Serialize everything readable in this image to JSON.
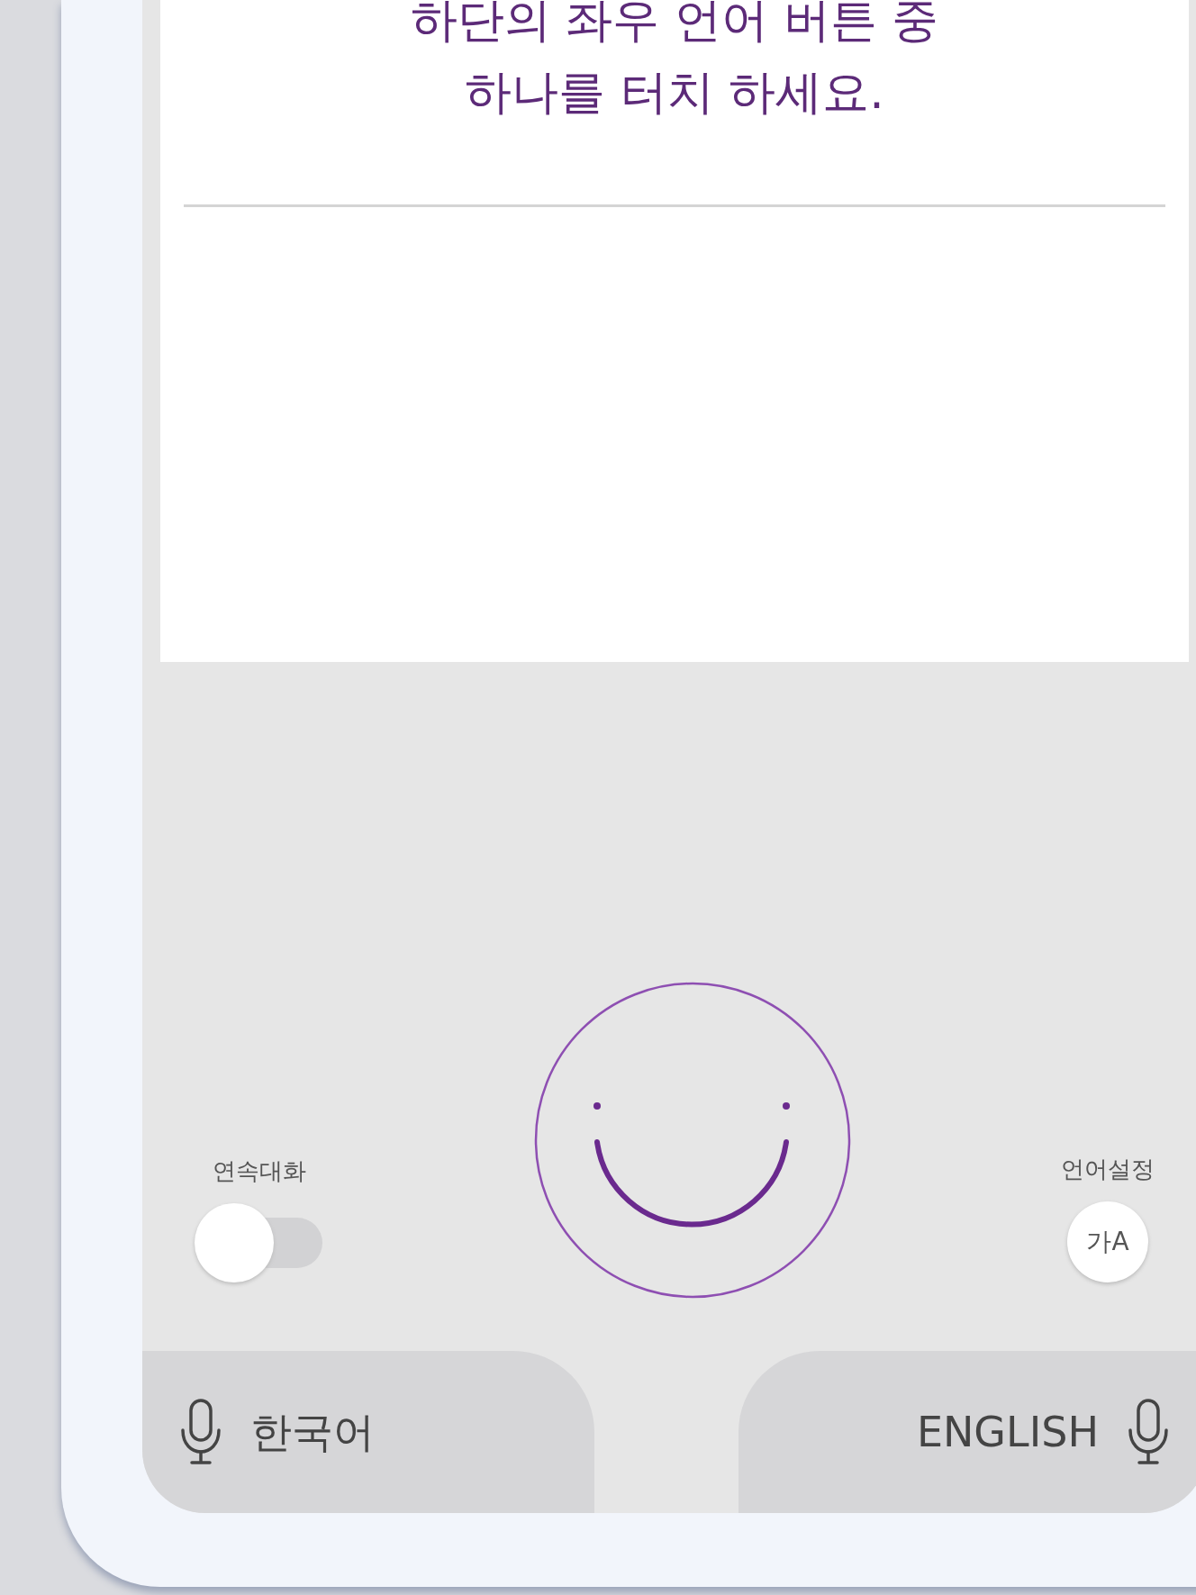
{
  "prompt": {
    "lines": [
      "하단의 좌우 언어 버튼 중",
      "하나를 터치 하세요."
    ]
  },
  "continuous_chat": {
    "label": "연속대화",
    "on": false
  },
  "language_settings": {
    "label": "언어설정",
    "icon_text": "가A"
  },
  "language_buttons": [
    {
      "label": "한국어",
      "kind": "leading"
    },
    {
      "label": "ENGLISH",
      "kind": "trailing"
    }
  ]
}
